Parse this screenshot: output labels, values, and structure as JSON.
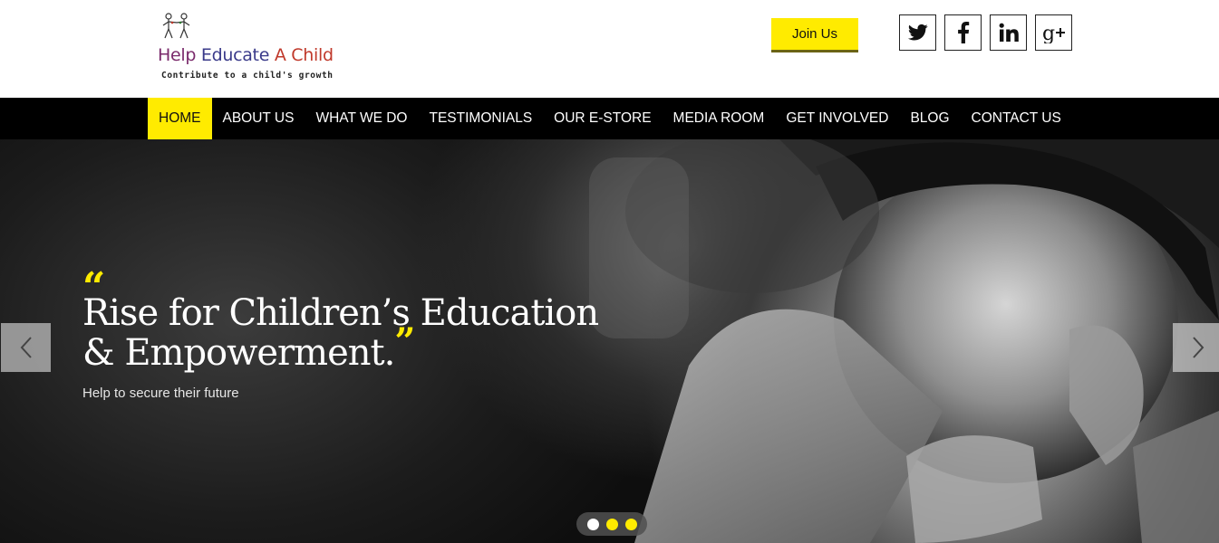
{
  "logo": {
    "title_part1": "Help ",
    "title_part2": "Educate ",
    "title_part3": "A Child",
    "tagline": "Contribute to a child's growth"
  },
  "header": {
    "join_label": "Join Us",
    "social": [
      {
        "icon": "twitter-icon"
      },
      {
        "icon": "facebook-icon"
      },
      {
        "icon": "linkedin-icon"
      },
      {
        "icon": "google-plus-icon"
      }
    ]
  },
  "nav": {
    "items": [
      {
        "label": "HOME",
        "active": true
      },
      {
        "label": "ABOUT US"
      },
      {
        "label": "WHAT WE DO"
      },
      {
        "label": "TESTIMONIALS"
      },
      {
        "label": "OUR E-STORE"
      },
      {
        "label": "MEDIA ROOM"
      },
      {
        "label": "GET INVOLVED"
      },
      {
        "label": "BLOG"
      },
      {
        "label": "CONTACT US"
      }
    ]
  },
  "hero": {
    "quote_open": "“",
    "headline_line1": "Rise for Children’s Education",
    "headline_line2": "& Empowerment.",
    "quote_close": "”",
    "subline": "Help to secure their future",
    "slides_count": 3,
    "active_slide": 1
  },
  "colors": {
    "accent": "#ffeb00",
    "nav_bg": "#000000"
  }
}
